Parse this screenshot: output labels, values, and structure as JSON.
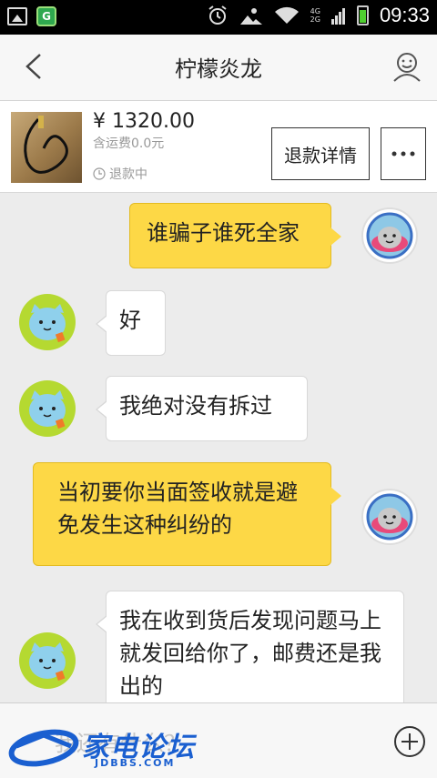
{
  "status_bar": {
    "time": "09:33",
    "network": "4G",
    "network2": "2G"
  },
  "header": {
    "title": "柠檬炎龙"
  },
  "product": {
    "price": "¥ 1320.00",
    "shipping": "含运费0.0元",
    "status": "退款中",
    "refund_button": "退款详情",
    "more_button": "···"
  },
  "messages": [
    {
      "side": "me",
      "text": "谁骗子谁死全家"
    },
    {
      "side": "them",
      "text": "好"
    },
    {
      "side": "them",
      "text": "我绝对没有拆过"
    },
    {
      "side": "me",
      "text": "当初要你当面签收就是避免发生这种纠纷的"
    },
    {
      "side": "them",
      "text": "我在收到货后发现问题马上就发回给你了，邮费还是我出的"
    }
  ],
  "input": {
    "placeholder": "我还有什么？"
  },
  "watermark": {
    "text": "家电论坛",
    "sub": "JDBBS.COM"
  },
  "colors": {
    "my_bubble": "#fdd846",
    "their_bubble": "#ffffff",
    "avatar_green": "#b5d931"
  }
}
